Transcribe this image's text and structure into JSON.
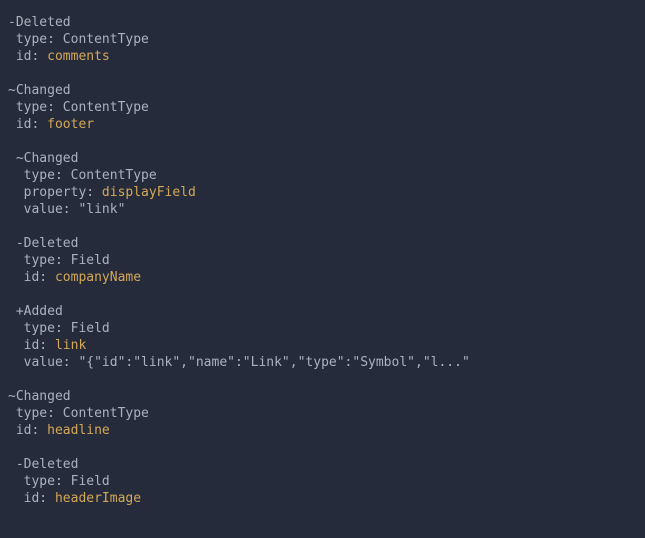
{
  "lines": [
    {
      "text": "-Deleted",
      "class": "text",
      "indent": 0
    },
    {
      "text": " type: ContentType",
      "class": "text",
      "indent": 0
    },
    {
      "prefix": " id: ",
      "value": "comments",
      "indent": 0
    },
    {
      "blank": true
    },
    {
      "text": "~Changed",
      "class": "text",
      "indent": 0
    },
    {
      "text": " type: ContentType",
      "class": "text",
      "indent": 0
    },
    {
      "prefix": " id: ",
      "value": "footer",
      "indent": 0
    },
    {
      "blank": true
    },
    {
      "text": " ~Changed",
      "class": "text",
      "indent": 1
    },
    {
      "text": "  type: ContentType",
      "class": "text",
      "indent": 1
    },
    {
      "prefix": "  property: ",
      "value": "displayField",
      "indent": 1
    },
    {
      "text": "  value: \"link\"",
      "class": "text",
      "indent": 1
    },
    {
      "blank": true
    },
    {
      "text": " -Deleted",
      "class": "text",
      "indent": 1
    },
    {
      "text": "  type: Field",
      "class": "text",
      "indent": 1
    },
    {
      "prefix": "  id: ",
      "value": "companyName",
      "indent": 1
    },
    {
      "blank": true
    },
    {
      "text": " +Added",
      "class": "text",
      "indent": 1
    },
    {
      "text": "  type: Field",
      "class": "text",
      "indent": 1
    },
    {
      "prefix": "  id: ",
      "value": "link",
      "indent": 1
    },
    {
      "text": "  value: \"{\"id\":\"link\",\"name\":\"Link\",\"type\":\"Symbol\",\"l...\"",
      "class": "text",
      "indent": 1
    },
    {
      "blank": true
    },
    {
      "text": "~Changed",
      "class": "text",
      "indent": 0
    },
    {
      "text": " type: ContentType",
      "class": "text",
      "indent": 0
    },
    {
      "prefix": " id: ",
      "value": "headline",
      "indent": 0
    },
    {
      "blank": true
    },
    {
      "text": " -Deleted",
      "class": "text",
      "indent": 1
    },
    {
      "text": "  type: Field",
      "class": "text",
      "indent": 1
    },
    {
      "prefix": "  id: ",
      "value": "headerImage",
      "indent": 1
    }
  ]
}
